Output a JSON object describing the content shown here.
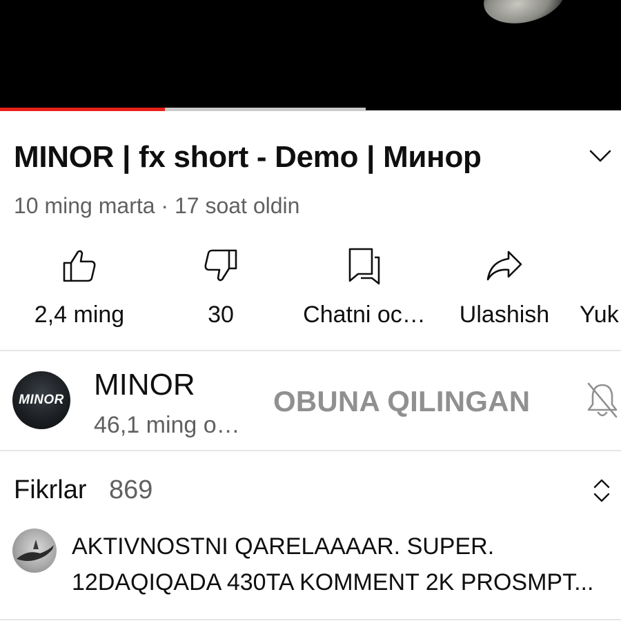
{
  "video": {
    "progress_watched": 0.265,
    "progress_buffered": 0.589
  },
  "title": "MINOR | fx short - Demo | Минор",
  "meta": "10 ming marta · 17 soat oldin",
  "actions": [
    {
      "icon": "thumbs-up-icon",
      "label": "2,4 ming"
    },
    {
      "icon": "thumbs-down-icon",
      "label": "30"
    },
    {
      "icon": "chat-icon",
      "label": "Chatni oc…"
    },
    {
      "icon": "share-icon",
      "label": "Ulashish"
    },
    {
      "icon": "",
      "label": "Yuk"
    }
  ],
  "channel": {
    "avatar_text": "MINOR",
    "name": "MINOR",
    "subscribers": "46,1 ming o…",
    "subscribe_label": "OBUNA QILINGAN",
    "bell_icon": "bell-off-icon"
  },
  "comments": {
    "title": "Fikrlar",
    "count": "869",
    "sort_icon": "expand-collapse-icon",
    "top_comment": {
      "line1": "AKTIVNOSTNI QARELAAAAR. SUPER.",
      "line2": "12DAQIQADA 430TA KOMMENT 2K PROSMPT..."
    }
  },
  "colors": {
    "progress": "#e62117",
    "buffer": "#c9c9c9",
    "secondary_text": "#606060",
    "subscribed_text": "#909090"
  }
}
